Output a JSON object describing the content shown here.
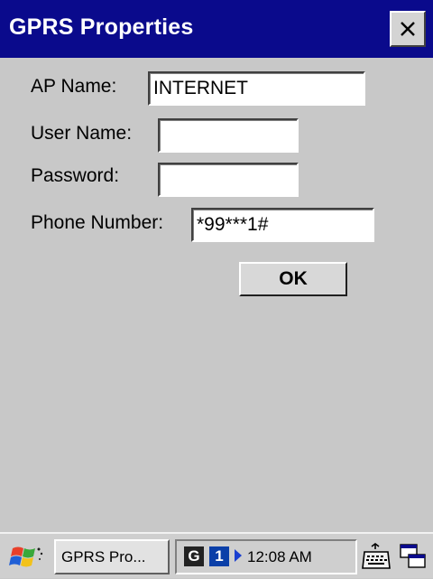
{
  "window": {
    "title": "GPRS Properties",
    "close_icon": "close-icon"
  },
  "form": {
    "ap_name": {
      "label": "AP Name:",
      "value": "INTERNET"
    },
    "user_name": {
      "label": "User Name:",
      "value": ""
    },
    "password": {
      "label": "Password:",
      "value": ""
    },
    "phone_number": {
      "label": "Phone Number:",
      "value": "*99***1#"
    },
    "ok_label": "OK"
  },
  "taskbar": {
    "start_icon": "windows-flag-icon",
    "task_button_label": "GPRS Pro...",
    "tray": {
      "g_badge": "G",
      "one_badge": "1",
      "time": "12:08 AM"
    },
    "keyboard_icon": "keyboard-icon",
    "desktop_icon": "desktop-icon"
  },
  "colors": {
    "titlebar": "#0a0a8c",
    "dialog_bg": "#c8c8c8",
    "taskbar_bg": "#cfcfcf",
    "badge_blue": "#0a3fa8"
  }
}
